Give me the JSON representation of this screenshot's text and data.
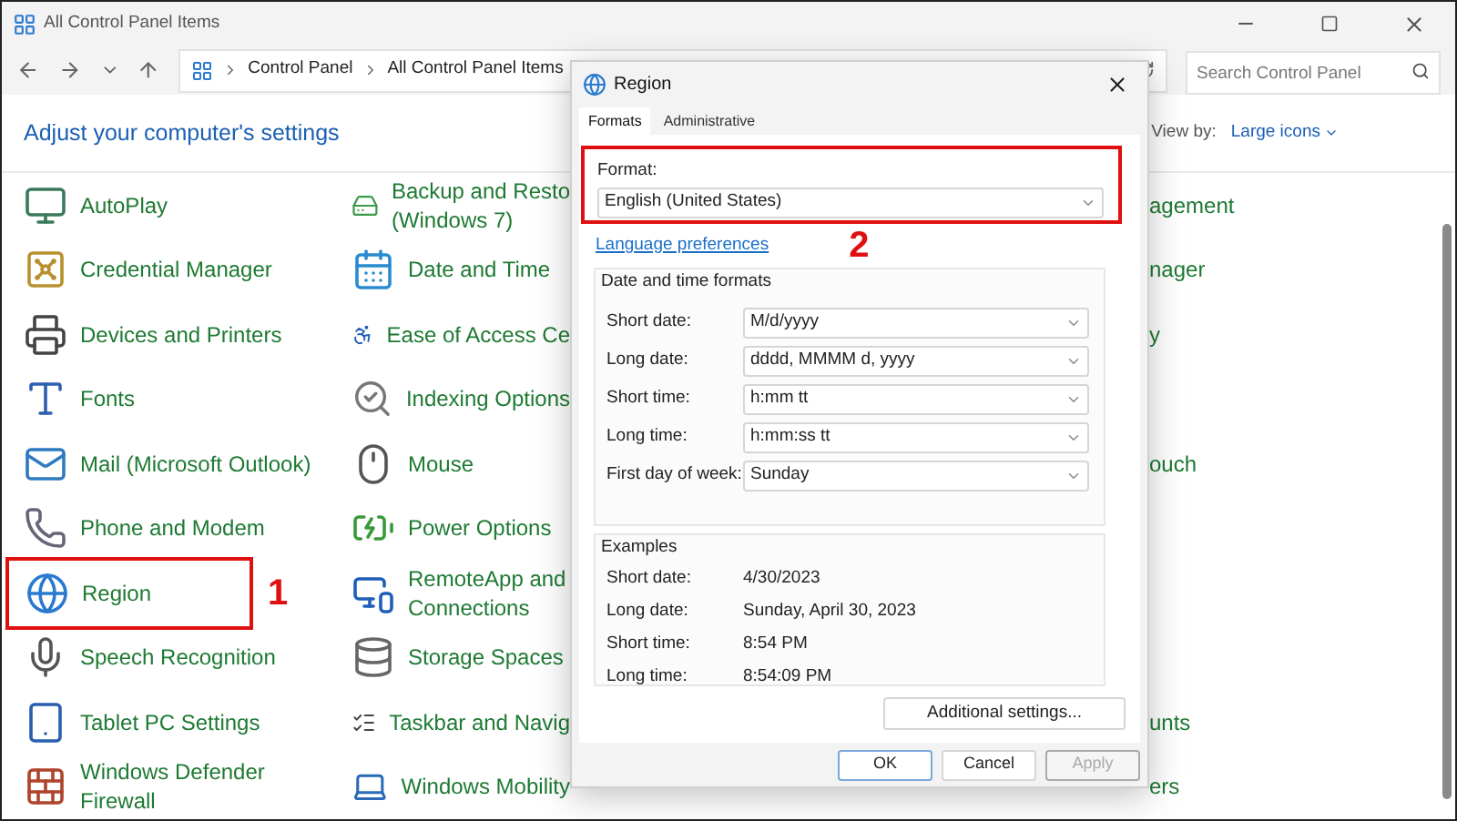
{
  "window": {
    "title": "All Control Panel Items"
  },
  "nav": {
    "breadcrumb": [
      "Control Panel",
      "All Control Panel Items"
    ],
    "search": {
      "placeholder": "Search Control Panel"
    }
  },
  "header": {
    "title": "Adjust your computer's settings",
    "view_by_label": "View by:",
    "view_by_value": "Large icons"
  },
  "rows": [
    {
      "left": {
        "lines": [
          "AutoPlay"
        ]
      },
      "middle": {
        "lines": [
          "Backup and Resto",
          "(Windows 7)"
        ]
      },
      "right": {
        "lines": [
          "agement"
        ]
      }
    },
    {
      "left": {
        "lines": [
          "Credential Manager"
        ]
      },
      "middle": {
        "lines": [
          "Date and Time"
        ]
      },
      "right": {
        "lines": [
          "nager"
        ]
      }
    },
    {
      "left": {
        "lines": [
          "Devices and Printers"
        ]
      },
      "middle": {
        "lines": [
          "Ease of Access Ce"
        ]
      },
      "right": {
        "lines": [
          "y"
        ]
      }
    },
    {
      "left": {
        "lines": [
          "Fonts"
        ]
      },
      "middle": {
        "lines": [
          "Indexing Options"
        ]
      }
    },
    {
      "left": {
        "lines": [
          "Mail (Microsoft Outlook)"
        ]
      },
      "middle": {
        "lines": [
          "Mouse"
        ]
      },
      "right": {
        "lines": [
          "ouch"
        ]
      }
    },
    {
      "left": {
        "lines": [
          "Phone and Modem"
        ]
      },
      "middle": {
        "lines": [
          "Power Options"
        ]
      }
    },
    {
      "left": {
        "lines": [
          "Region"
        ],
        "callout": "1"
      },
      "middle": {
        "lines": [
          "RemoteApp and",
          "Connections"
        ]
      }
    },
    {
      "left": {
        "lines": [
          "Speech Recognition"
        ]
      },
      "middle": {
        "lines": [
          "Storage Spaces"
        ]
      }
    },
    {
      "left": {
        "lines": [
          "Tablet PC Settings"
        ]
      },
      "middle": {
        "lines": [
          "Taskbar and Navig"
        ]
      },
      "right": {
        "lines": [
          "unts"
        ]
      }
    },
    {
      "left": {
        "lines": [
          "Windows Defender",
          "Firewall"
        ]
      },
      "middle": {
        "lines": [
          "Windows Mobility"
        ]
      },
      "right": {
        "lines": [
          "ers"
        ]
      }
    }
  ],
  "dialog": {
    "title": "Region",
    "tabs": [
      {
        "label": "Formats",
        "selected": true
      },
      {
        "label": "Administrative",
        "selected": false
      }
    ],
    "format": {
      "label": "Format:",
      "value": "English (United States)",
      "callout": "2"
    },
    "link": "Language preferences",
    "formats_group": {
      "title": "Date and time formats",
      "fields": [
        {
          "label": "Short date:",
          "value": "M/d/yyyy"
        },
        {
          "label": "Long date:",
          "value": "dddd, MMMM d, yyyy"
        },
        {
          "label": "Short time:",
          "value": "h:mm tt"
        },
        {
          "label": "Long time:",
          "value": "h:mm:ss tt"
        },
        {
          "label": "First day of week:",
          "value": "Sunday"
        }
      ]
    },
    "examples_group": {
      "title": "Examples",
      "rows": [
        {
          "label": "Short date:",
          "value": "4/30/2023"
        },
        {
          "label": "Long date:",
          "value": "Sunday, April 30, 2023"
        },
        {
          "label": "Short time:",
          "value": "8:54 PM"
        },
        {
          "label": "Long time:",
          "value": "8:54:09 PM"
        }
      ]
    },
    "additional_button": "Additional settings...",
    "buttons": [
      {
        "label": "OK",
        "disabled": false,
        "default": true
      },
      {
        "label": "Cancel",
        "disabled": false,
        "default": false
      },
      {
        "label": "Apply",
        "disabled": true,
        "default": false
      }
    ]
  }
}
